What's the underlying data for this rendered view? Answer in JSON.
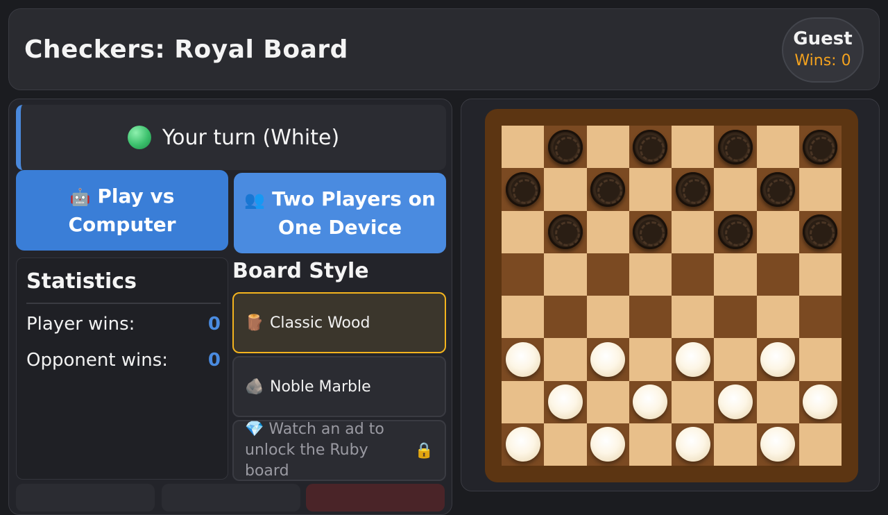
{
  "header": {
    "title": "Checkers: Royal Board",
    "player_name": "Guest",
    "player_wins": "Wins: 0"
  },
  "turn": {
    "text": "Your turn (White)",
    "indicator_color": "#3bc06c"
  },
  "modes": [
    {
      "icon": "🤖",
      "label": "Play vs Computer"
    },
    {
      "icon": "👥",
      "label": "Two Players on One Device"
    }
  ],
  "statistics": {
    "title": "Statistics",
    "rows": [
      {
        "label": "Player wins:",
        "value": "0"
      },
      {
        "label": "Opponent wins:",
        "value": "0"
      }
    ]
  },
  "board_style": {
    "title": "Board Style",
    "options": [
      {
        "icon": "🪵",
        "label": "Classic Wood",
        "selected": true
      },
      {
        "icon": "🪨",
        "label": "Noble Marble",
        "selected": false
      },
      {
        "icon": "💎",
        "label": "Watch an ad to unlock the Ruby board",
        "locked": true,
        "lock_icon": "🔒"
      }
    ]
  },
  "colors": {
    "accent_blue": "#4a8be0",
    "accent_gold": "#f4b41e",
    "board_light": "#e8bf8a",
    "board_dark": "#7b4a22",
    "frame": "#5c3512"
  },
  "board": {
    "rows": [
      ".b.b.b.b",
      "b.b.b.b.",
      ".b.b.b.b",
      "........",
      "........",
      "w.w.w.w.",
      ".w.w.w.w",
      "w.w.w.w."
    ]
  }
}
